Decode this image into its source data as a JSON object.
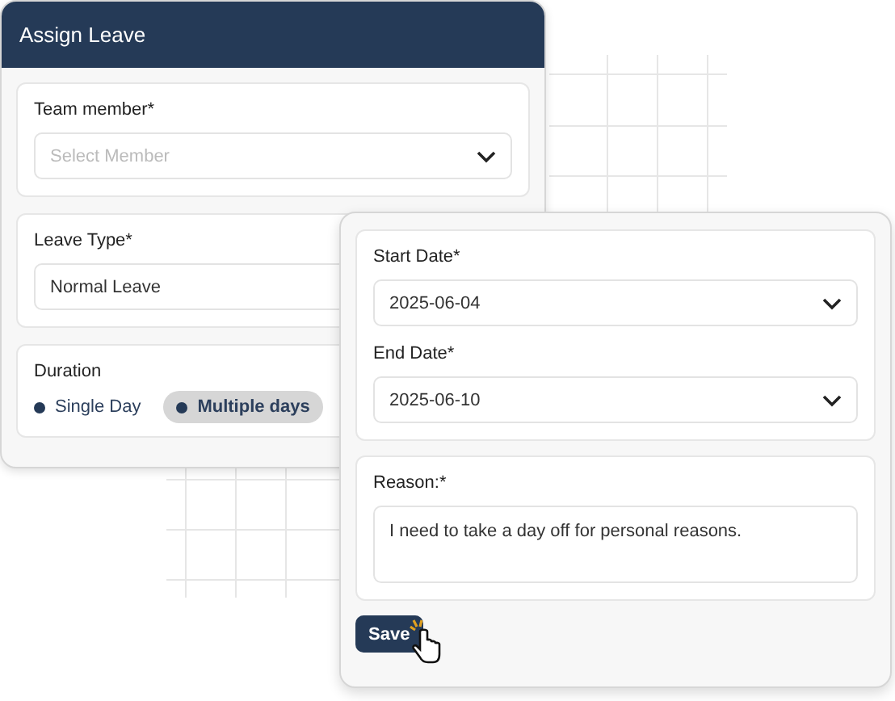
{
  "window": {
    "title": "Assign Leave"
  },
  "team_member": {
    "label": "Team member*",
    "placeholder": "Select Member"
  },
  "leave_type": {
    "label": "Leave Type*",
    "value": "Normal Leave"
  },
  "duration": {
    "label": "Duration",
    "options": [
      {
        "label": "Single Day",
        "selected": false
      },
      {
        "label": "Multiple days",
        "selected": true
      }
    ]
  },
  "dates_panel": {
    "start_date": {
      "label": "Start Date*",
      "value": "2025-06-04"
    },
    "end_date": {
      "label": "End Date*",
      "value": "2025-06-10"
    },
    "reason": {
      "label": "Reason:*",
      "value": "I need to take a day off for personal reasons."
    },
    "save_button": "Save"
  }
}
